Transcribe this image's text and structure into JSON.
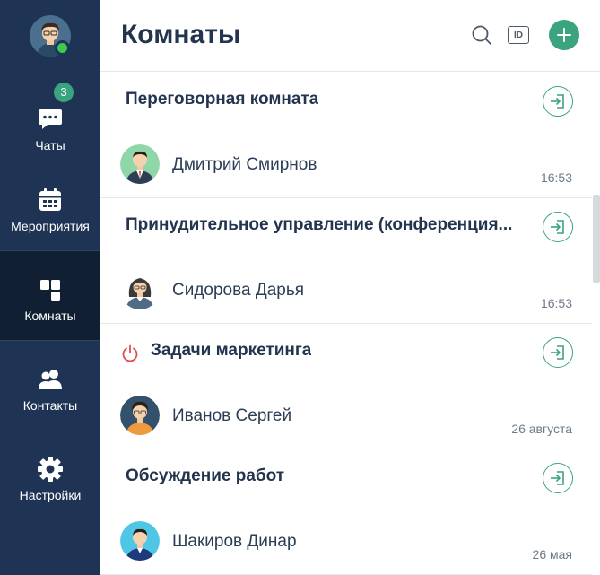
{
  "sidebar": {
    "nav": [
      {
        "label": "Чаты",
        "icon": "chat-icon",
        "badge": "3"
      },
      {
        "label": "Мероприятия",
        "icon": "calendar-icon"
      },
      {
        "label": "Комнаты",
        "icon": "rooms-icon",
        "active": true
      },
      {
        "label": "Контакты",
        "icon": "contacts-icon"
      },
      {
        "label": "Настройки",
        "icon": "settings-icon"
      }
    ]
  },
  "header": {
    "title": "Комнаты",
    "id_button_label": "ID"
  },
  "rooms": [
    {
      "title": "Переговорная комната",
      "person": "Дмитрий Смирнов",
      "time": "16:53"
    },
    {
      "title": "Принудительное управление (конференция...",
      "person": "Сидорова Дарья",
      "time": "16:53"
    },
    {
      "title": "Задачи маркетинга",
      "person": "Иванов Сергей",
      "time": "26 августа",
      "status_icon": "power-icon"
    },
    {
      "title": "Обсуждение работ",
      "person": "Шакиров Динар",
      "time": "26 мая"
    }
  ],
  "colors": {
    "sidebar_bg": "#1f3454",
    "sidebar_active": "#111f33",
    "accent": "#3aa47e",
    "online": "#3ccb4e",
    "power": "#d9534f",
    "title_text": "#23344e"
  }
}
